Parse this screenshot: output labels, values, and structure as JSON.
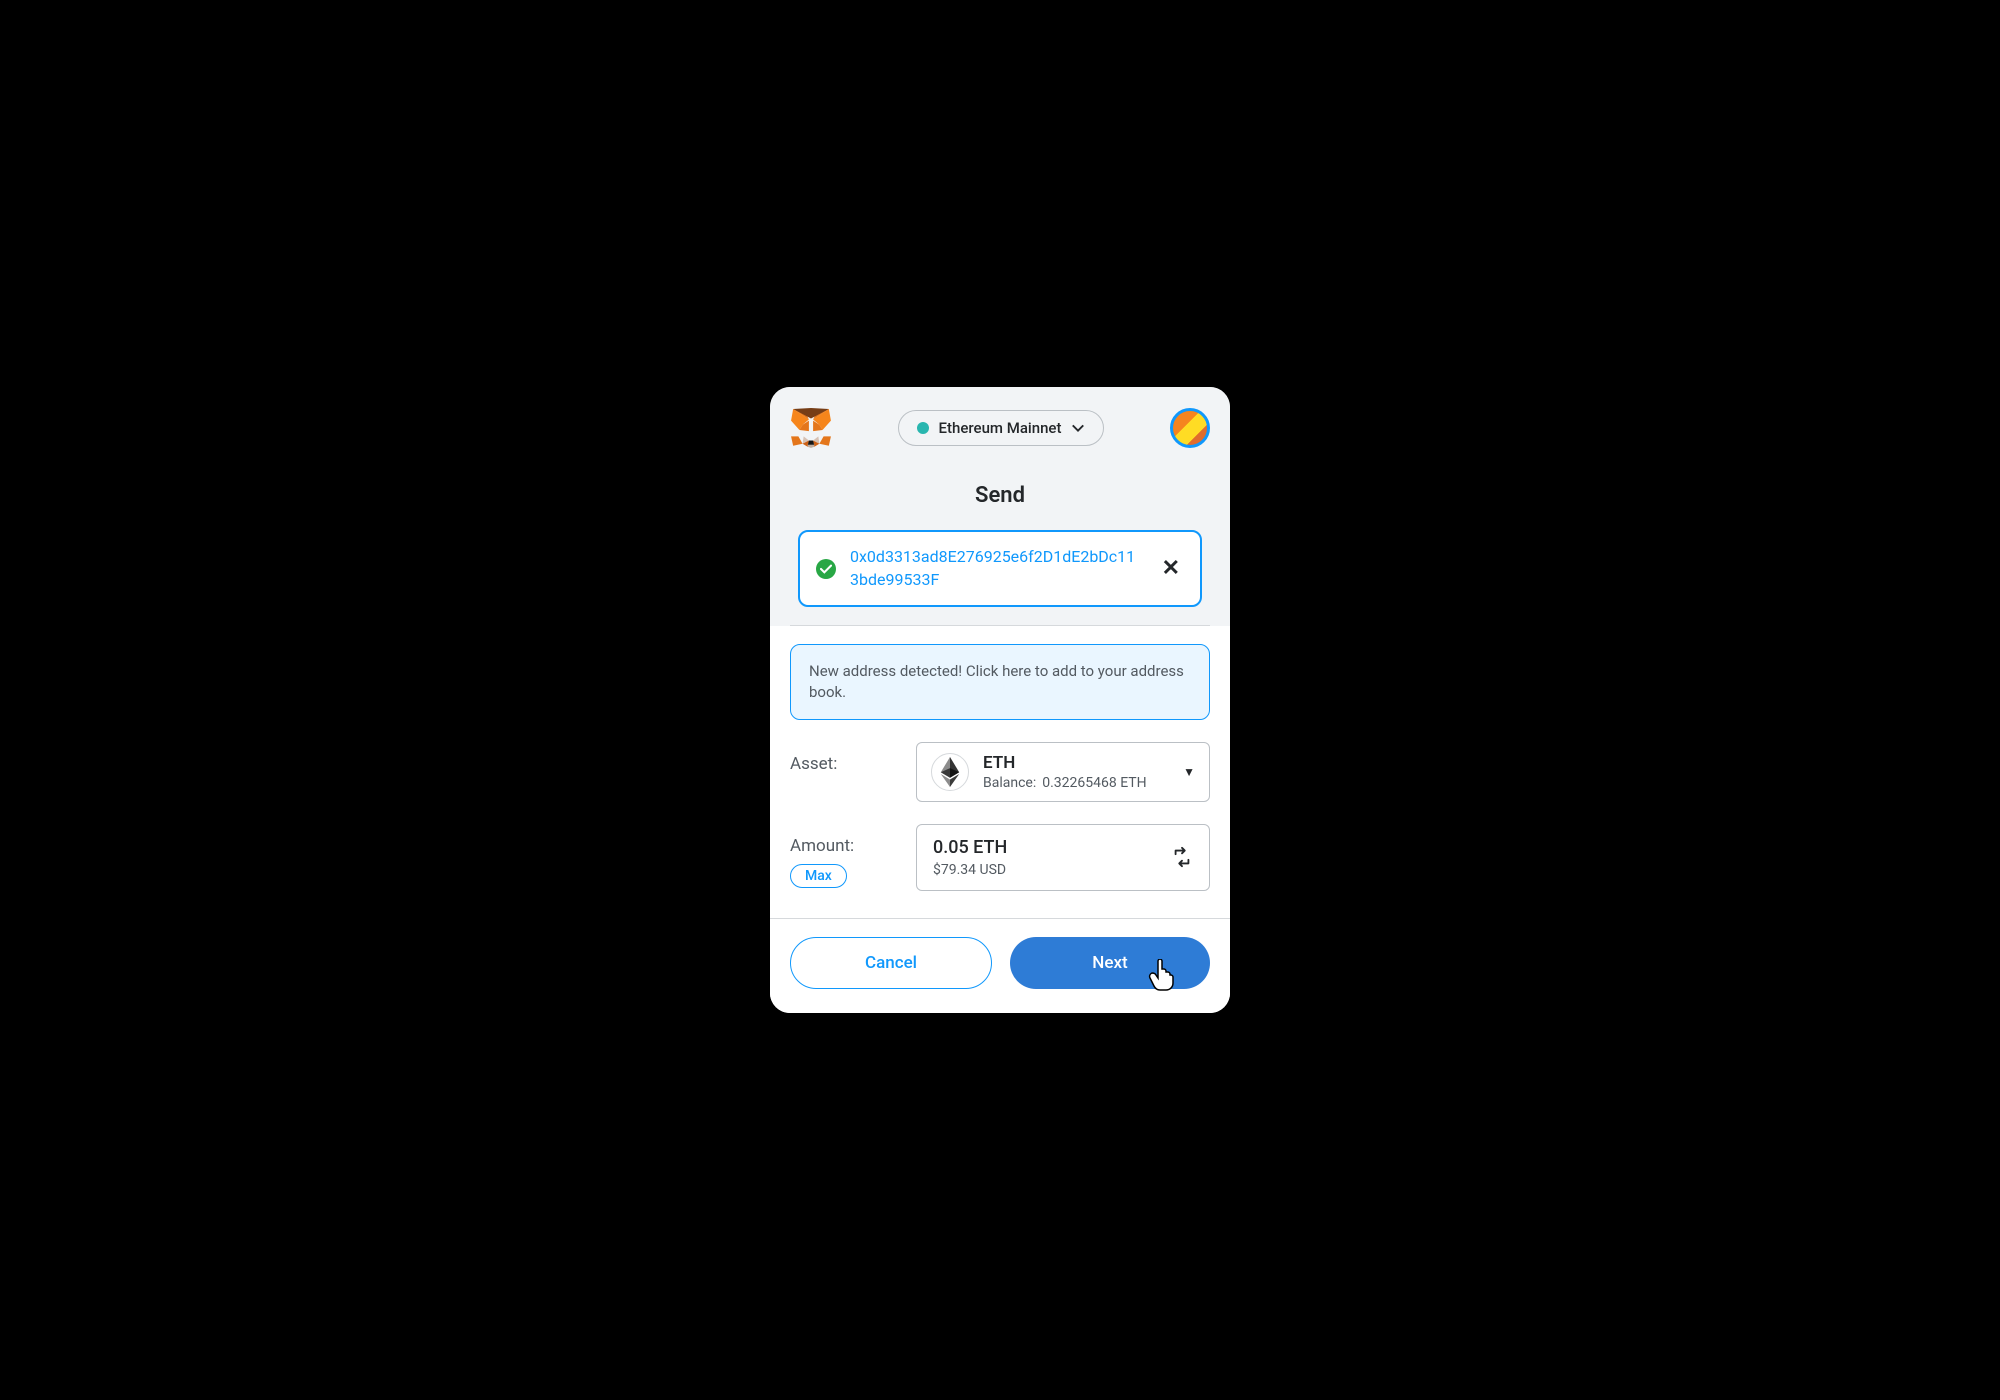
{
  "header": {
    "network": "Ethereum Mainnet",
    "network_dot_color": "#29b6af"
  },
  "page": {
    "title": "Send"
  },
  "recipient": {
    "address": "0x0d3313ad8E276925e6f2D1dE2bDc113bde99533F"
  },
  "info_banner": {
    "text": "New address detected! Click here to add to your address book."
  },
  "asset": {
    "label": "Asset:",
    "symbol": "ETH",
    "balance_label": "Balance:",
    "balance_value": "0.32265468 ETH"
  },
  "amount": {
    "label": "Amount:",
    "max_label": "Max",
    "value_primary": "0.05 ETH",
    "value_secondary": "$79.34 USD"
  },
  "footer": {
    "cancel": "Cancel",
    "next": "Next"
  }
}
